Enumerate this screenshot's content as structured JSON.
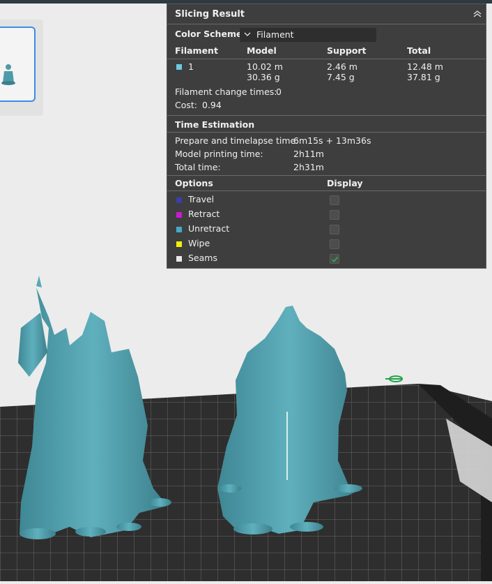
{
  "panel": {
    "title": "Slicing Result",
    "color_scheme_label": "Color Scheme",
    "color_scheme_value": "Filament",
    "headers": {
      "filament": "Filament",
      "model": "Model",
      "support": "Support",
      "total": "Total"
    },
    "filament_row": {
      "id": "1",
      "swatch_color": "#6ec9e0",
      "model_length": "10.02 m",
      "model_weight": "30.36 g",
      "support_length": "2.46 m",
      "support_weight": "7.45 g",
      "total_length": "12.48 m",
      "total_weight": "37.81 g"
    },
    "filament_change_label": "Filament change times:",
    "filament_change_value": "0",
    "cost_label": "Cost:",
    "cost_value": "0.94",
    "time_estimation_title": "Time Estimation",
    "prepare_label": "Prepare and timelapse time:",
    "prepare_value": "6m15s + 13m36s",
    "model_time_label": "Model printing time:",
    "model_time_value": "2h11m",
    "total_time_label": "Total time:",
    "total_time_value": "2h31m",
    "options_header": "Options",
    "display_header": "Display",
    "options": [
      {
        "label": "Travel",
        "color": "#3a3fa8",
        "checked": false
      },
      {
        "label": "Retract",
        "color": "#c81bcf",
        "checked": false
      },
      {
        "label": "Unretract",
        "color": "#46a9c9",
        "checked": false
      },
      {
        "label": "Wipe",
        "color": "#f2f200",
        "checked": false
      },
      {
        "label": "Seams",
        "color": "#e8e8e8",
        "checked": true
      }
    ]
  },
  "colors": {
    "panel_bg": "#3e3e3e",
    "model": "#4f9aa8",
    "bed": "#2b2b2b",
    "accent_check": "#2fa84f"
  }
}
